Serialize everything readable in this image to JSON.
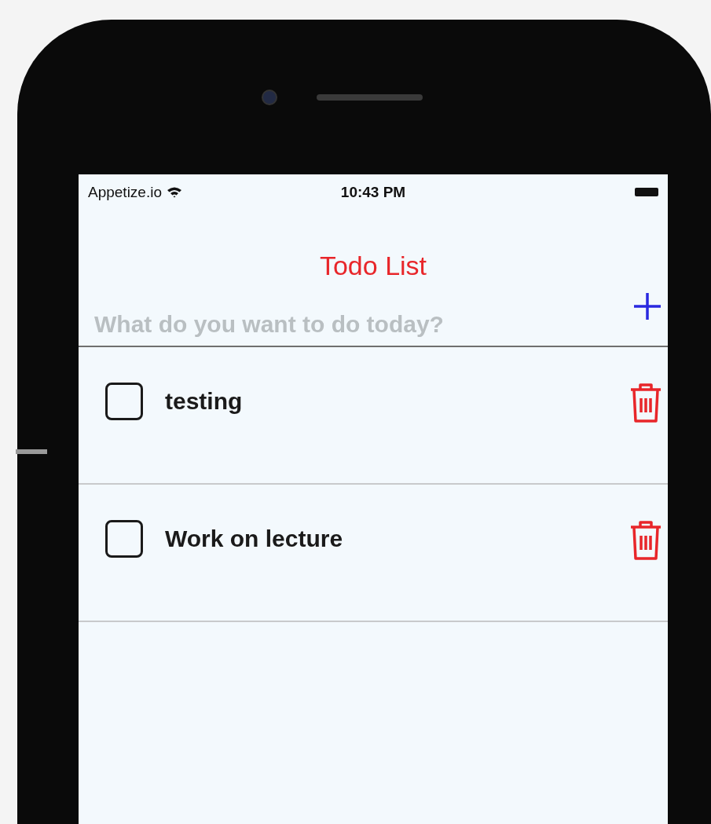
{
  "status_bar": {
    "carrier": "Appetize.io",
    "time": "10:43 PM"
  },
  "title": "Todo List",
  "new_todo": {
    "placeholder": "What do you want to do today?"
  },
  "todos": [
    {
      "text": "testing",
      "checked": false
    },
    {
      "text": "Work on lecture",
      "checked": false
    }
  ]
}
